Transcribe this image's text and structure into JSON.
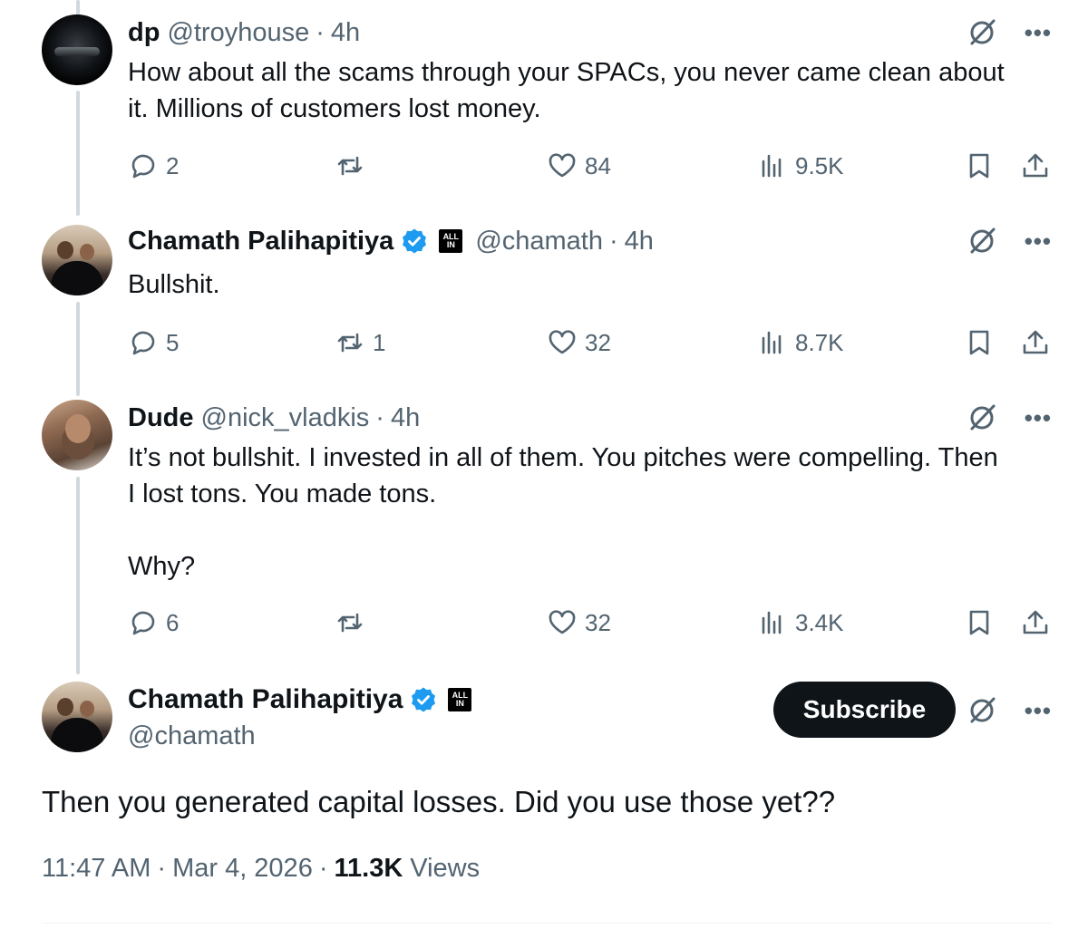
{
  "tweets": [
    {
      "name": "dp",
      "handle": "@troyhouse",
      "separator": "·",
      "time": "4h",
      "text": "How about all the scams through your SPACs, you never came clean about\nit. Millions of customers lost money.",
      "replies": "2",
      "reposts": "",
      "likes": "84",
      "views": "9.5K"
    },
    {
      "name": "Chamath Palihapitiya",
      "verified": true,
      "affiliate_badge": [
        "ALL",
        "IN"
      ],
      "handle": "@chamath",
      "separator": "·",
      "time": "4h",
      "text": "Bullshit.",
      "replies": "5",
      "reposts": "1",
      "likes": "32",
      "views": "8.7K"
    },
    {
      "name": "Dude",
      "handle": "@nick_vladkis",
      "separator": "·",
      "time": "4h",
      "text": "It’s not bullshit. I invested in all of them. You pitches were compelling. Then\nI lost tons. You made tons.\n\nWhy?",
      "replies": "6",
      "reposts": "",
      "likes": "32",
      "views": "3.4K"
    }
  ],
  "main_tweet": {
    "name": "Chamath Palihapitiya",
    "verified": true,
    "affiliate_badge": [
      "ALL",
      "IN"
    ],
    "handle": "@chamath",
    "subscribe_label": "Subscribe",
    "text": "Then you generated capital losses. Did you use those yet??",
    "time": "11:47 AM",
    "date": "Mar 4, 2026",
    "separator": "·",
    "views_count": "11.3K",
    "views_label": "Views"
  },
  "icons": {
    "reply": "reply-icon",
    "repost": "repost-icon",
    "like": "heart-icon",
    "views": "analytics-icon",
    "bookmark": "bookmark-icon",
    "share": "share-icon",
    "grok": "grok-icon",
    "more": "more-icon",
    "verified": "verified-badge-icon"
  },
  "colors": {
    "text": "#0f1419",
    "secondary": "#536471",
    "verified": "#1d9bf0",
    "thread_line": "#cfd9de",
    "button": "#0f1419"
  }
}
